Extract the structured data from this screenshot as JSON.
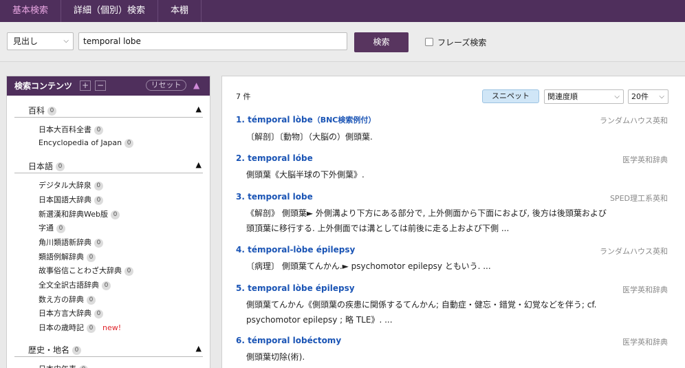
{
  "nav": {
    "tabs": [
      {
        "label": "基本検索",
        "active": true
      },
      {
        "label": "詳細（個別）検索",
        "active": false
      },
      {
        "label": "本棚",
        "active": false
      }
    ]
  },
  "search": {
    "field": "見出し",
    "query": "temporal lobe",
    "button": "検索",
    "phrase_label": "フレーズ検索"
  },
  "sidebar": {
    "title": "検索コンテンツ",
    "plus": "+",
    "minus": "−",
    "reset": "リセット",
    "collapse_glyph": "▲",
    "categories": [
      {
        "label": "百科",
        "count": "0",
        "toggle": "▲",
        "items": [
          {
            "label": "日本大百科全書",
            "count": "0"
          },
          {
            "label": "Encyclopedia of Japan",
            "count": "0"
          }
        ]
      },
      {
        "label": "日本語",
        "count": "0",
        "toggle": "▲",
        "items": [
          {
            "label": "デジタル大辞泉",
            "count": "0"
          },
          {
            "label": "日本国語大辞典",
            "count": "0"
          },
          {
            "label": "新選漢和辞典Web版",
            "count": "0"
          },
          {
            "label": "字通",
            "count": "0"
          },
          {
            "label": "角川類語新辞典",
            "count": "0"
          },
          {
            "label": "類語例解辞典",
            "count": "0"
          },
          {
            "label": "故事俗信ことわざ大辞典",
            "count": "0"
          },
          {
            "label": "全文全訳古語辞典",
            "count": "0"
          },
          {
            "label": "数え方の辞典",
            "count": "0"
          },
          {
            "label": "日本方言大辞典",
            "count": "0"
          },
          {
            "label": "日本の歳時記",
            "count": "0",
            "badge": "new!"
          }
        ]
      },
      {
        "label": "歴史・地名",
        "count": "0",
        "toggle": "▲",
        "items": [
          {
            "label": "日本史年表",
            "count": "0"
          }
        ]
      }
    ]
  },
  "results": {
    "count_text": "7 件",
    "snippet_label": "スニペット",
    "sort": "関連度順",
    "per_page": "20件",
    "items": [
      {
        "num": "1.",
        "title": "témporal lòbe",
        "tag": "（BNC検索例付）",
        "source": "ランダムハウス英和",
        "lines": [
          "〔解剖〕〔動物〕（大脳の）側頭葉."
        ]
      },
      {
        "num": "2.",
        "title": "temporal lóbe",
        "tag": "",
        "source": "医学英和辞典",
        "lines": [
          "側頭葉《大脳半球の下外側葉》."
        ]
      },
      {
        "num": "3.",
        "title": "temporal lobe",
        "tag": "",
        "source": "SPED理工系英和",
        "lines": [
          "《解剖》 側頭葉► 外側溝より下方にある部分で, 上外側面から下面におよび, 後方は後頭葉および",
          "頭頂葉に移行する. 上外側面では溝としては前後に走る上および下側 ..."
        ]
      },
      {
        "num": "4.",
        "title": "témporal-lòbe épilepsy",
        "tag": "",
        "source": "ランダムハウス英和",
        "lines": [
          "〔病理〕 側頭葉てんかん.► psychomotor epilepsy ともいう. ..."
        ]
      },
      {
        "num": "5.",
        "title": "temporal lòbe épilepsy",
        "tag": "",
        "source": "医学英和辞典",
        "lines": [
          "側頭葉てんかん《側頭葉の疾患に関係するてんかん; 自動症・健忘・錯覚・幻覚などを伴う; cf.",
          "psychomotor epilepsy ; 略 TLE》. ..."
        ]
      },
      {
        "num": "6.",
        "title": "témporal lobéctomy",
        "tag": "",
        "source": "医学英和辞典",
        "lines": [
          "側頭葉切除(術)."
        ]
      }
    ]
  }
}
